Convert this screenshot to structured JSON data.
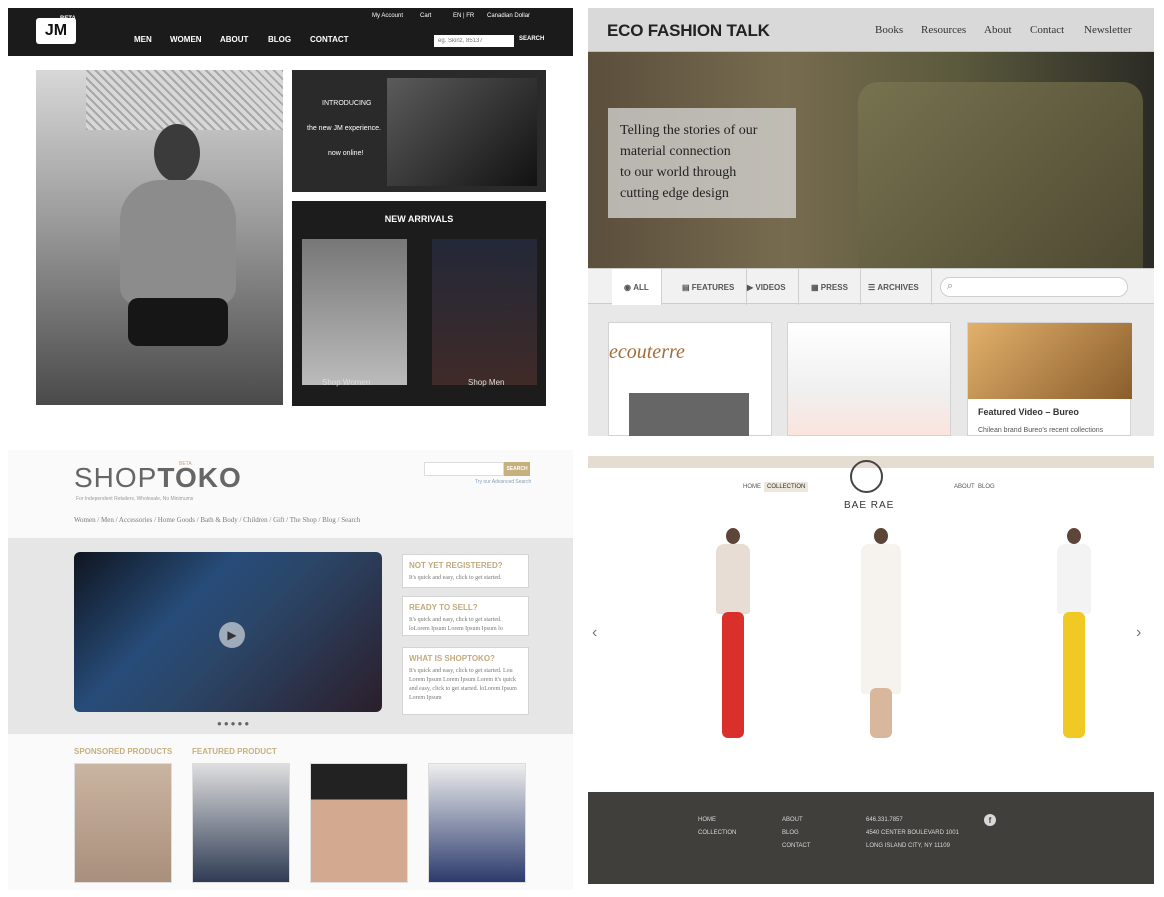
{
  "jm": {
    "beta": "BETA",
    "logo": "JM",
    "top_links": [
      "My Account",
      "Cart",
      "EN | FR",
      "Canadian Dollar"
    ],
    "nav": [
      "MEN",
      "WOMEN",
      "ABOUT",
      "BLOG",
      "CONTACT"
    ],
    "search_placeholder": "eg. Skinz, 85137",
    "search_label": "SEARCH",
    "intro": [
      "INTRODUCING",
      "the new JM experience.",
      "now online!"
    ],
    "new_arrivals": "NEW ARRIVALS",
    "shop_women": "Shop Women",
    "shop_men": "Shop Men"
  },
  "eco": {
    "title": "ECO FASHION TALK",
    "nav": [
      "Books",
      "Resources",
      "About",
      "Contact",
      "Newsletter"
    ],
    "hero_lines": [
      "Telling the stories of our",
      "material connection",
      "to our world through",
      "cutting edge design"
    ],
    "tabs": [
      "ALL",
      "FEATURES",
      "VIDEOS",
      "PRESS",
      "ARCHIVES"
    ],
    "card1_logo": "ecouterre",
    "card3_title": "Featured Video – Bureo",
    "card3_text": "Chilean brand Bureo’s recent collections"
  },
  "toko": {
    "logo_left": "SHOP",
    "logo_right": "TOKO",
    "beta": "BETA",
    "tagline": "For Independent Retailers, Wholesale, No Minimums",
    "search_label": "SEARCH",
    "search_link": "Try our Advanced Search",
    "nav": "Women / Men / Accessories / Home Goods / Bath & Body / Children / Gift / The Shop / Blog / Search",
    "box1_title": "NOT YET REGISTERED?",
    "box1_text": "It's quick and easy, click to get started.",
    "box2_title": "READY TO SELL?",
    "box2_text": "It's quick and easy, click to get started. loLorem Ipsum Lorem Ipsum Ipsum lo",
    "box3_title": "WHAT IS SHOPTOKO?",
    "box3_text": "It's quick and easy, click to get started. Lou Lorem Ipsum Lorem Ipsum Lorem it's quick and easy, click to get started. loLorem Ipsum Lorem Ipsum",
    "sponsored": "SPONSORED PRODUCTS",
    "featured": "FEATURED PRODUCT",
    "dots": "●●●●●"
  },
  "bae": {
    "nav_left": [
      "HOME",
      "COLLECTION"
    ],
    "nav_right": [
      "ABOUT",
      "BLOG"
    ],
    "name": "BAE RAE",
    "arrow_left": "‹",
    "arrow_right": "›",
    "footer_col1": [
      "HOME",
      "COLLECTION"
    ],
    "footer_col2": [
      "ABOUT",
      "BLOG",
      "CONTACT"
    ],
    "footer_col3": [
      "646.331.7857",
      "4540 CENTER BOULEVARD 1001",
      "LONG ISLAND CITY, NY 11109"
    ],
    "social": "f"
  }
}
